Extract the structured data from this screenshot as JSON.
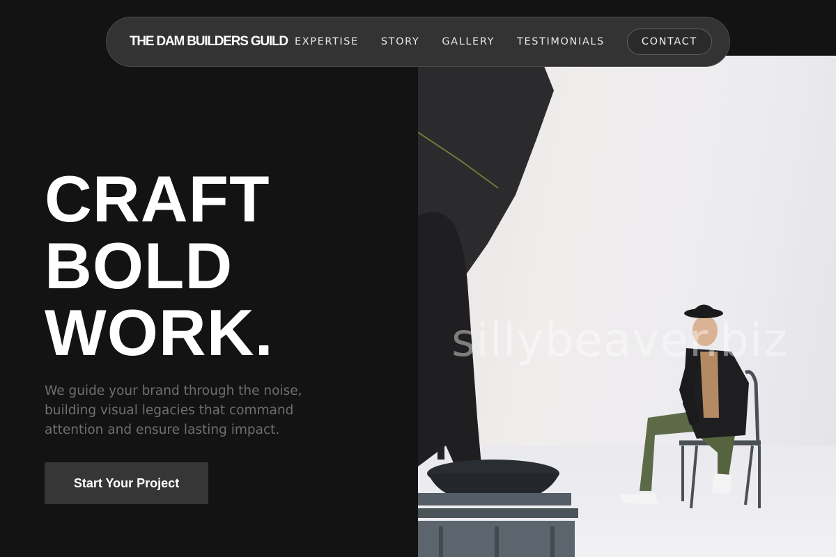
{
  "header": {
    "brand": "THE DAM BUILDERS GUILD",
    "nav": [
      {
        "label": "EXPERTISE"
      },
      {
        "label": "STORY"
      },
      {
        "label": "GALLERY"
      },
      {
        "label": "TESTIMONIALS"
      }
    ],
    "contact_label": "CONTACT"
  },
  "hero": {
    "headline_lines": [
      "CRAFT",
      "BOLD",
      "WORK."
    ],
    "subcopy": "We guide your brand through the noise, building visual legacies that command attention and ensure lasting impact.",
    "cta_label": "Start Your Project",
    "image_watermark": "sillybeaver.biz"
  },
  "colors": {
    "background": "#131313",
    "nav_background": "#333333",
    "cta_background": "#363636",
    "subcopy_text": "#6f6f6f"
  }
}
